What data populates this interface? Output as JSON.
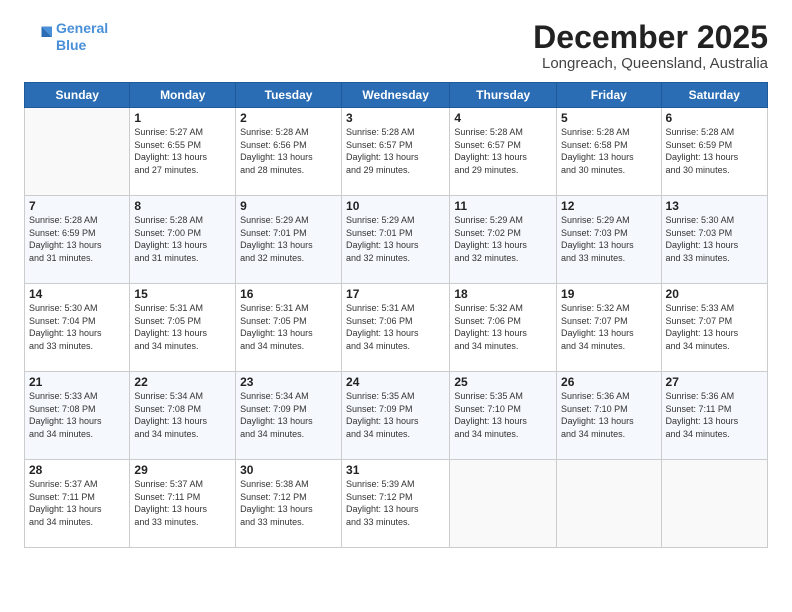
{
  "logo": {
    "line1": "General",
    "line2": "Blue"
  },
  "title": "December 2025",
  "location": "Longreach, Queensland, Australia",
  "weekdays": [
    "Sunday",
    "Monday",
    "Tuesday",
    "Wednesday",
    "Thursday",
    "Friday",
    "Saturday"
  ],
  "weeks": [
    [
      {
        "day": "",
        "info": ""
      },
      {
        "day": "1",
        "info": "Sunrise: 5:27 AM\nSunset: 6:55 PM\nDaylight: 13 hours\nand 27 minutes."
      },
      {
        "day": "2",
        "info": "Sunrise: 5:28 AM\nSunset: 6:56 PM\nDaylight: 13 hours\nand 28 minutes."
      },
      {
        "day": "3",
        "info": "Sunrise: 5:28 AM\nSunset: 6:57 PM\nDaylight: 13 hours\nand 29 minutes."
      },
      {
        "day": "4",
        "info": "Sunrise: 5:28 AM\nSunset: 6:57 PM\nDaylight: 13 hours\nand 29 minutes."
      },
      {
        "day": "5",
        "info": "Sunrise: 5:28 AM\nSunset: 6:58 PM\nDaylight: 13 hours\nand 30 minutes."
      },
      {
        "day": "6",
        "info": "Sunrise: 5:28 AM\nSunset: 6:59 PM\nDaylight: 13 hours\nand 30 minutes."
      }
    ],
    [
      {
        "day": "7",
        "info": "Sunrise: 5:28 AM\nSunset: 6:59 PM\nDaylight: 13 hours\nand 31 minutes."
      },
      {
        "day": "8",
        "info": "Sunrise: 5:28 AM\nSunset: 7:00 PM\nDaylight: 13 hours\nand 31 minutes."
      },
      {
        "day": "9",
        "info": "Sunrise: 5:29 AM\nSunset: 7:01 PM\nDaylight: 13 hours\nand 32 minutes."
      },
      {
        "day": "10",
        "info": "Sunrise: 5:29 AM\nSunset: 7:01 PM\nDaylight: 13 hours\nand 32 minutes."
      },
      {
        "day": "11",
        "info": "Sunrise: 5:29 AM\nSunset: 7:02 PM\nDaylight: 13 hours\nand 32 minutes."
      },
      {
        "day": "12",
        "info": "Sunrise: 5:29 AM\nSunset: 7:03 PM\nDaylight: 13 hours\nand 33 minutes."
      },
      {
        "day": "13",
        "info": "Sunrise: 5:30 AM\nSunset: 7:03 PM\nDaylight: 13 hours\nand 33 minutes."
      }
    ],
    [
      {
        "day": "14",
        "info": "Sunrise: 5:30 AM\nSunset: 7:04 PM\nDaylight: 13 hours\nand 33 minutes."
      },
      {
        "day": "15",
        "info": "Sunrise: 5:31 AM\nSunset: 7:05 PM\nDaylight: 13 hours\nand 34 minutes."
      },
      {
        "day": "16",
        "info": "Sunrise: 5:31 AM\nSunset: 7:05 PM\nDaylight: 13 hours\nand 34 minutes."
      },
      {
        "day": "17",
        "info": "Sunrise: 5:31 AM\nSunset: 7:06 PM\nDaylight: 13 hours\nand 34 minutes."
      },
      {
        "day": "18",
        "info": "Sunrise: 5:32 AM\nSunset: 7:06 PM\nDaylight: 13 hours\nand 34 minutes."
      },
      {
        "day": "19",
        "info": "Sunrise: 5:32 AM\nSunset: 7:07 PM\nDaylight: 13 hours\nand 34 minutes."
      },
      {
        "day": "20",
        "info": "Sunrise: 5:33 AM\nSunset: 7:07 PM\nDaylight: 13 hours\nand 34 minutes."
      }
    ],
    [
      {
        "day": "21",
        "info": "Sunrise: 5:33 AM\nSunset: 7:08 PM\nDaylight: 13 hours\nand 34 minutes."
      },
      {
        "day": "22",
        "info": "Sunrise: 5:34 AM\nSunset: 7:08 PM\nDaylight: 13 hours\nand 34 minutes."
      },
      {
        "day": "23",
        "info": "Sunrise: 5:34 AM\nSunset: 7:09 PM\nDaylight: 13 hours\nand 34 minutes."
      },
      {
        "day": "24",
        "info": "Sunrise: 5:35 AM\nSunset: 7:09 PM\nDaylight: 13 hours\nand 34 minutes."
      },
      {
        "day": "25",
        "info": "Sunrise: 5:35 AM\nSunset: 7:10 PM\nDaylight: 13 hours\nand 34 minutes."
      },
      {
        "day": "26",
        "info": "Sunrise: 5:36 AM\nSunset: 7:10 PM\nDaylight: 13 hours\nand 34 minutes."
      },
      {
        "day": "27",
        "info": "Sunrise: 5:36 AM\nSunset: 7:11 PM\nDaylight: 13 hours\nand 34 minutes."
      }
    ],
    [
      {
        "day": "28",
        "info": "Sunrise: 5:37 AM\nSunset: 7:11 PM\nDaylight: 13 hours\nand 34 minutes."
      },
      {
        "day": "29",
        "info": "Sunrise: 5:37 AM\nSunset: 7:11 PM\nDaylight: 13 hours\nand 33 minutes."
      },
      {
        "day": "30",
        "info": "Sunrise: 5:38 AM\nSunset: 7:12 PM\nDaylight: 13 hours\nand 33 minutes."
      },
      {
        "day": "31",
        "info": "Sunrise: 5:39 AM\nSunset: 7:12 PM\nDaylight: 13 hours\nand 33 minutes."
      },
      {
        "day": "",
        "info": ""
      },
      {
        "day": "",
        "info": ""
      },
      {
        "day": "",
        "info": ""
      }
    ]
  ]
}
